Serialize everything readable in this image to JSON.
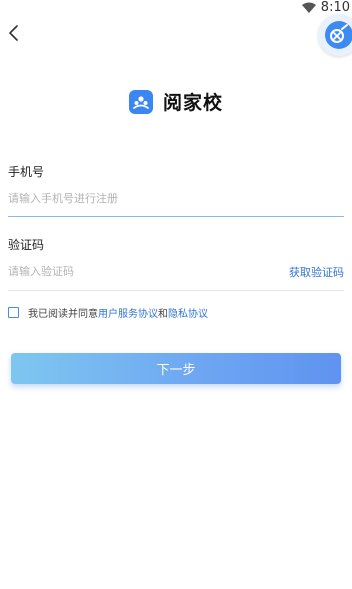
{
  "status_bar": {
    "time": "8:10",
    "wifi_icon": "wifi-icon"
  },
  "header": {
    "back_icon": "chevron-left-icon",
    "badge_icon": "floating-assistant-icon"
  },
  "brand": {
    "logo_icon": "app-logo-icon",
    "name": "阅家校"
  },
  "phone": {
    "label": "手机号",
    "placeholder": "请输入手机号进行注册",
    "value": ""
  },
  "code": {
    "label": "验证码",
    "placeholder": "请输入验证码",
    "value": "",
    "get_code_label": "获取验证码"
  },
  "agreement": {
    "prefix": "我已阅读并同意",
    "terms_link": "用户服务协议",
    "conjunction": "和",
    "privacy_link": "隐私协议",
    "checked": false
  },
  "actions": {
    "next_label": "下一步"
  },
  "colors": {
    "accent": "#2f74d6",
    "active_divider": "#8ab8ee",
    "inactive_divider": "#e6e6e6",
    "button_gradient_start": "#7ec7f0",
    "button_gradient_end": "#5f93f0"
  }
}
